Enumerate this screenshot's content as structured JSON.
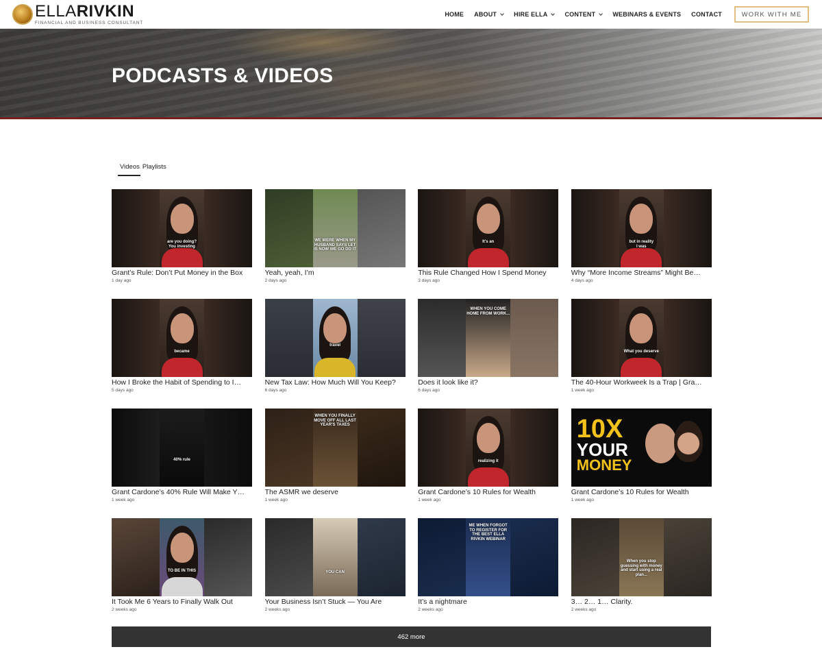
{
  "header": {
    "logo": {
      "name_light": "ELLA",
      "name_bold": "RIVKIN",
      "tagline": "FINANCIAL AND BUSINESS CONSULTANT"
    },
    "nav": [
      {
        "label": "HOME",
        "dropdown": false
      },
      {
        "label": "ABOUT",
        "dropdown": true
      },
      {
        "label": "HIRE ELLA",
        "dropdown": true
      },
      {
        "label": "CONTENT",
        "dropdown": true
      },
      {
        "label": "WEBINARS & EVENTS",
        "dropdown": false
      },
      {
        "label": "CONTACT",
        "dropdown": false
      }
    ],
    "cta": "WORK WITH ME"
  },
  "hero": {
    "title": "PODCASTS & VIDEOS"
  },
  "tabs": [
    {
      "label": "Videos",
      "active": true
    },
    {
      "label": "Playlists",
      "active": false
    }
  ],
  "videos": [
    {
      "title": "Grant’s Rule: Don’t Put Money in the Box",
      "date": "1 day ago",
      "caption": "are you doing?\nYou investing",
      "style": "ella"
    },
    {
      "title": "Yeah, yeah, I’m",
      "date": "2 days ago",
      "caption": "WE WERE WHEN MY HUSBAND SAYS LET IS NOW WE GO DO IT",
      "style": "dog"
    },
    {
      "title": "This Rule Changed How I Spend Money",
      "date": "3 days ago",
      "caption": "It's an",
      "style": "ella"
    },
    {
      "title": "Why “More Income Streams” Might Be…",
      "date": "4 days ago",
      "caption": "but in reality\nI was",
      "style": "ella"
    },
    {
      "title": "How I Broke the Habit of Spending to I…",
      "date": "5 days ago",
      "caption": "became",
      "style": "ella"
    },
    {
      "title": "New Tax Law: How Much Will You Keep?",
      "date": "6 days ago",
      "caption": "travel",
      "style": "city"
    },
    {
      "title": "Does it look like it?",
      "date": "6 days ago",
      "caption": "WHEN YOU COME HOME FROM WORK...",
      "style": "baby"
    },
    {
      "title": "The 40-Hour Workweek Is a Trap | Gra…",
      "date": "1 week ago",
      "caption": "What you deserve",
      "style": "ella"
    },
    {
      "title": "Grant Cardone’s 40% Rule Will Make Y…",
      "date": "1 week ago",
      "caption": "40% rule",
      "style": "grant"
    },
    {
      "title": "The ASMR we deserve",
      "date": "1 week ago",
      "caption": "WHEN YOU FINALLY MOVE OFF ALL LAST YEAR'S TAXES",
      "style": "coins"
    },
    {
      "title": "Grant Cardone’s 10 Rules for Wealth",
      "date": "1 week ago",
      "caption": "realizing it",
      "style": "ella"
    },
    {
      "title": "Grant Cardone’s 10 Rules for Wealth",
      "date": "1 week ago",
      "caption": "",
      "style": "tenx",
      "tenx": [
        "10X",
        "YOUR",
        "MONEY"
      ]
    },
    {
      "title": "It Took Me 6 Years to Finally Walk Out",
      "date": "2 weeks ago",
      "caption": "TO BE IN THIS",
      "style": "podcast"
    },
    {
      "title": "Your Business Isn’t Stuck — You Are",
      "date": "2 weeks ago",
      "caption": "YOU CAN",
      "style": "man"
    },
    {
      "title": "It’s a nightmare",
      "date": "2 weeks ago",
      "caption": "ME WHEN FORGOT TO REGISTER FOR THE BEST ELLA RIVKIN WEBINAR",
      "style": "night"
    },
    {
      "title": "3… 2… 1… Clarity.",
      "date": "2 weeks ago",
      "caption": "When you stop guessing with money and start using a real plan...",
      "style": "library"
    }
  ],
  "more_button": "462 more",
  "colors": {
    "accent_gold": "#e0be80",
    "hero_stripe": "#7a1f1f",
    "more_bg": "#333333",
    "shirt_red": "#c0262b"
  }
}
